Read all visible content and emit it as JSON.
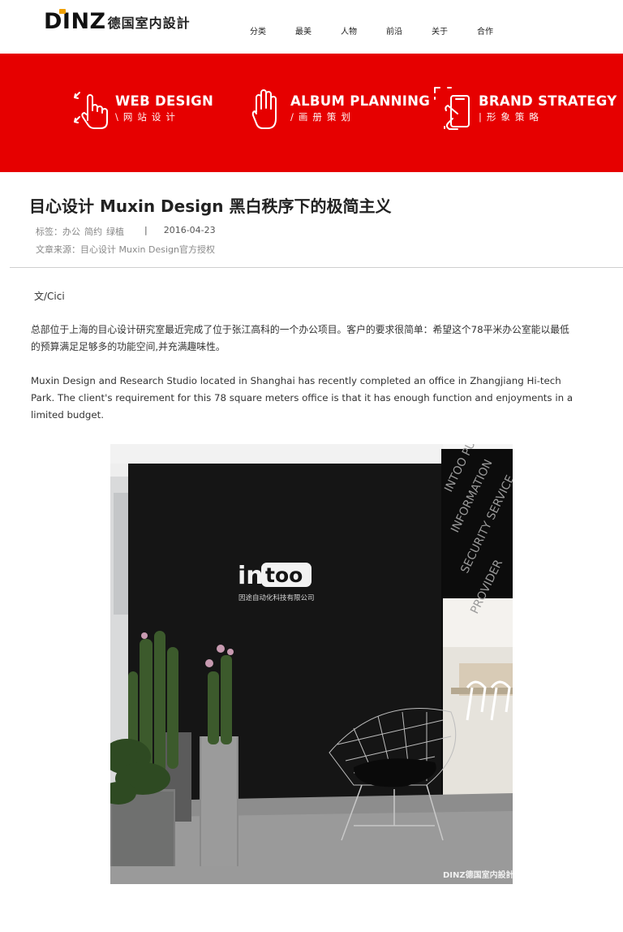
{
  "header": {
    "logo_text": "DINZ",
    "logo_cn": "德国室内設計",
    "nav": [
      "分类",
      "最美",
      "人物",
      "前沿",
      "关于",
      "合作"
    ]
  },
  "banner": {
    "features": [
      {
        "en": "WEB DESIGN",
        "cn": "\\网站设计",
        "icon": "touch-hand-icon"
      },
      {
        "en": "ALBUM PLANNING",
        "cn": "/画册策划",
        "icon": "palm-hand-icon"
      },
      {
        "en": "BRAND STRATEGY",
        "cn": "|形象策略",
        "icon": "phone-scan-icon"
      }
    ]
  },
  "article": {
    "title": "目心设计 Muxin Design 黑白秩序下的极简主义",
    "tags_label": "标签：办公",
    "tags": [
      "简约",
      "绿植"
    ],
    "separator": "|",
    "date": "2016-04-23",
    "source": "文章来源：目心设计 Muxin Design官方授权",
    "author": "文/Cici",
    "paragraph_cn": "总部位于上海的目心设计研究室最近完成了位于张江高科的一个办公项目。客户的要求很简单：希望这个78平米办公室能以最低的预算满足足够多的功能空间,并充满趣味性。",
    "paragraph_en": "Muxin Design and Research Studio located in Shanghai has recently completed an office in Zhangjiang Hi-tech Park. The client's requirement for this 78 square meters  office is that it has enough function and enjoyments in a limited budget."
  },
  "photo": {
    "sign_text_a": "in",
    "sign_text_b": "too",
    "sign_sub": "因途自动化科技有限公司",
    "glass_text": "INTOO PURPOSE PREPARATION INFORMATION SECURITY SERVICE PROVIDER BUSINESS",
    "watermark": "DINZ德国室内設計"
  }
}
